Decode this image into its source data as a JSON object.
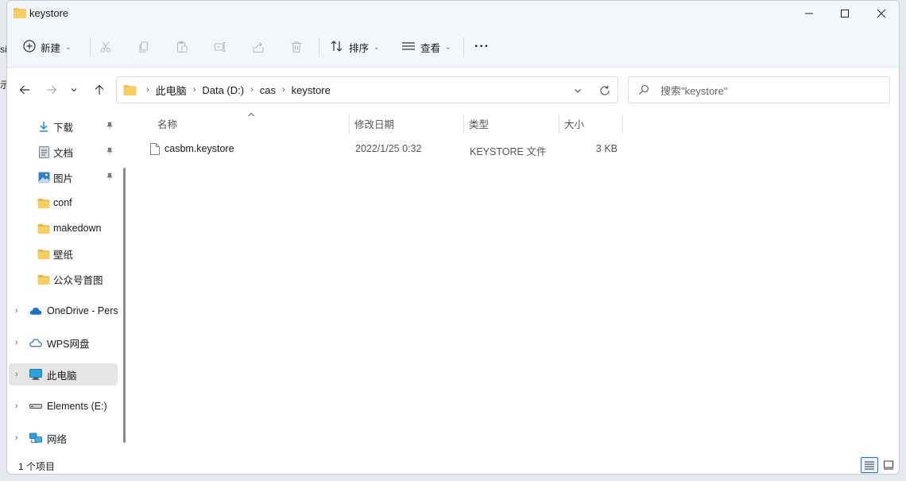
{
  "window": {
    "title": "keystore"
  },
  "toolbar": {
    "new_label": "新建",
    "sort_label": "排序",
    "view_label": "查看",
    "more_label": "···"
  },
  "address": {
    "crumbs": [
      "此电脑",
      "Data (D:)",
      "cas",
      "keystore"
    ]
  },
  "search": {
    "placeholder": "搜索\"keystore\""
  },
  "nav": {
    "quick": [
      {
        "label": "下载"
      },
      {
        "label": "文档"
      },
      {
        "label": "图片"
      },
      {
        "label": "conf"
      },
      {
        "label": "makedown"
      },
      {
        "label": "壁纸"
      },
      {
        "label": "公众号首图"
      }
    ],
    "roots": [
      {
        "label": "OneDrive - Pers"
      },
      {
        "label": "WPS网盘"
      },
      {
        "label": "此电脑"
      },
      {
        "label": "Elements (E:)"
      },
      {
        "label": "网络"
      }
    ]
  },
  "columns": {
    "name": "名称",
    "date": "修改日期",
    "type": "类型",
    "size": "大小"
  },
  "files": [
    {
      "name": "casbm.keystore",
      "date": "2022/1/25 0:32",
      "type": "KEYSTORE 文件",
      "size": "3 KB"
    }
  ],
  "status": {
    "count": "1 个项目"
  },
  "colors": {
    "accent": "#1e6fc9",
    "folder": "#f2c14e",
    "chrome": "#f3f6fb"
  }
}
